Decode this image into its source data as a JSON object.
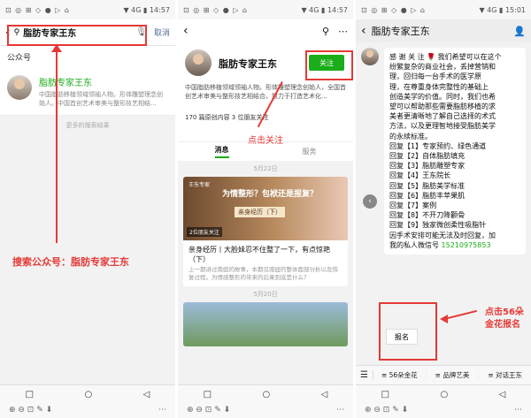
{
  "status": {
    "p1_time": "14:57",
    "p2_time": "14:57",
    "p3_time": "15:01",
    "p1_icons": "⊡ ◎ ⊞ ◇ ● ▷ ⌂",
    "p2_icons": "⊡ ◎ ⊞ ◇ ● ▷ ⌂",
    "p3_icons": "⊡ ◎ ⊞ ◇ ● ▷ ⌂",
    "right": "▼ 4G ▮"
  },
  "panel1": {
    "search_query": "脂肪专家王东",
    "cancel_label": "取消",
    "section_label": "公众号",
    "result_name": "脂肪专家王东",
    "result_desc": "中国脂肪移植领域领袖人物。形体雕塑理念创始人。中国首创艺术审美与整形技艺相结...",
    "more_results": "更多的搜索结果",
    "caption": "搜索公众号：脂肪专家王东"
  },
  "panel2": {
    "profile_name": "脂肪专家王东",
    "follow_label": "关注",
    "profile_desc": "中国脂肪移植领域领袖人物。形体雕塑理念创始人，全国首创艺术审美与整形技艺相结合，致力于打造艺术化...",
    "stats": "170 篇原创内容  3 位朋友关注",
    "tab_messages": "消息",
    "tab_services": "服务",
    "date1": "5月22日",
    "cover_brand": "王东专家",
    "cover_overlay": "为情整形？包袱还是报复？",
    "cover_banner": "亲身经历（下）",
    "cover_tag": "2位朋友关注",
    "article_title": "亲身经历丨大脸妹忍不住整了一下，有点惊艳（下）",
    "article_excerpt": "上一期讲过南妞的故事，本期见南妞的整体面部分析以及恢复过程。为情感整形的带来的后果到底是什么？",
    "date2": "5月20日",
    "caption": "点击关注"
  },
  "panel3": {
    "nav_title": "脂肪专家王东",
    "message_lines": [
      "感 谢 关 注 🌹 我们希望可以在这个",
      "纷繁复杂的商业社会，丢掉营销和",
      "理，回归每一台手术的医学原",
      "理，在尊重身体完整性的基础上",
      "创造美学的价值。同时，我们也希",
      "望可以帮助那些需要脂肪移植的求",
      "美者更清晰地了解自己选择的术式",
      "方法，以及更理智地接受脂肪美学",
      "的永续标准。",
      "回复【1】专家预约、绿色通道",
      "回复【2】自体脂肪填充",
      "回复【3】脂肪雕塑专家",
      "回复【4】王东院长",
      "回复【5】脂肪美学标准",
      "回复【6】脂肪丰苹果肌",
      "回复【7】案例",
      "回复【8】不开刀降颧骨",
      "回复【9】独家微创柔性吸脂针",
      "因手术安排可能无法及时回复，加",
      "我的私人微信号 "
    ],
    "phone": "15210975853",
    "menu_popup": "报名",
    "menu_keyboard": "☰",
    "menu_items": [
      "≡ 56朵金花",
      "≡ 品牌艺美",
      "≡ 对话王东"
    ],
    "caption_line1": "点击56朵",
    "caption_line2": "金花报名"
  },
  "sys_buttons": [
    "□",
    "○",
    "◁"
  ],
  "tools": [
    "⊕ ⊖ ⊡ ✎ ⬇",
    "⋯"
  ]
}
